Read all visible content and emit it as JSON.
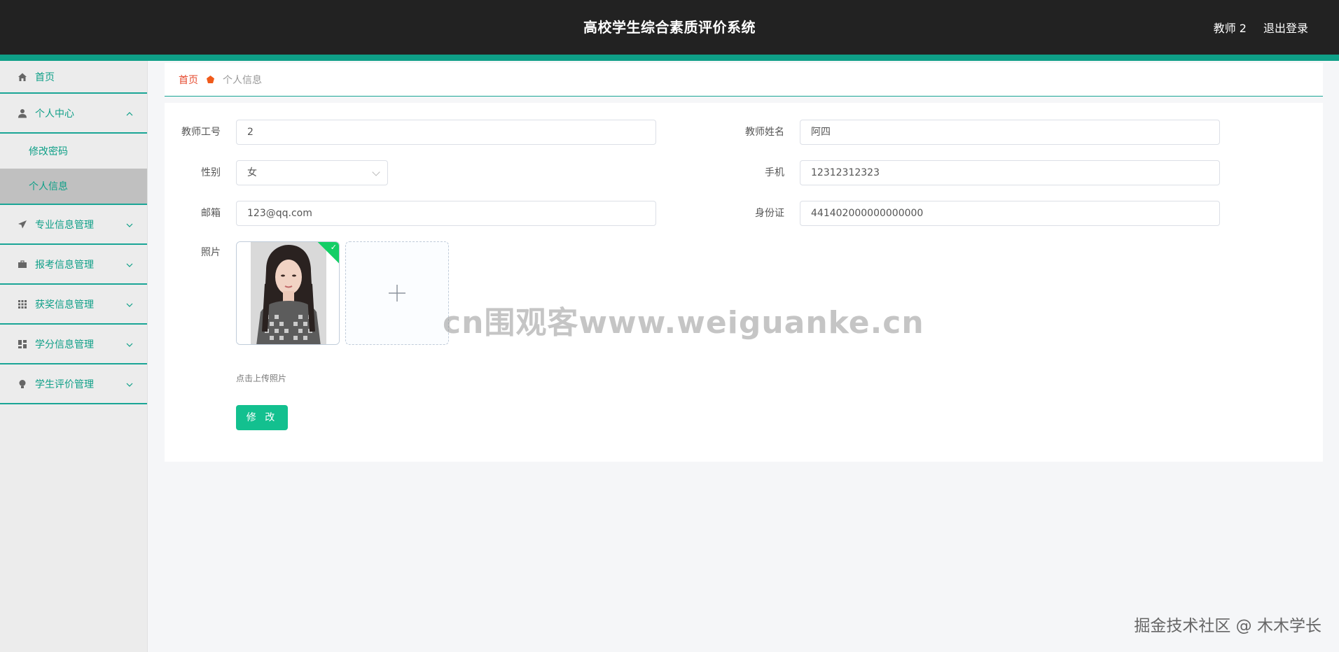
{
  "header": {
    "title": "高校学生综合素质评价系统",
    "user_name": "教师 2",
    "logout_label": "退出登录"
  },
  "sidebar": {
    "items": [
      {
        "label": "首页",
        "icon": "home-icon",
        "expanded": false
      },
      {
        "label": "个人中心",
        "icon": "user-icon",
        "expanded": true,
        "children": [
          {
            "label": "修改密码",
            "active": false
          },
          {
            "label": "个人信息",
            "active": true
          }
        ]
      },
      {
        "label": "专业信息管理",
        "icon": "paper-plane-icon",
        "expanded": false
      },
      {
        "label": "报考信息管理",
        "icon": "briefcase-icon",
        "expanded": false
      },
      {
        "label": "获奖信息管理",
        "icon": "grid-icon",
        "expanded": false
      },
      {
        "label": "学分信息管理",
        "icon": "dashboard-icon",
        "expanded": false
      },
      {
        "label": "学生评价管理",
        "icon": "lightbulb-icon",
        "expanded": false
      }
    ]
  },
  "breadcrumb": {
    "home": "首页",
    "current": "个人信息"
  },
  "form": {
    "teacher_id_label": "教师工号",
    "teacher_id_value": "2",
    "teacher_name_label": "教师姓名",
    "teacher_name_value": "阿四",
    "gender_label": "性别",
    "gender_value": "女",
    "phone_label": "手机",
    "phone_value": "12312312323",
    "email_label": "邮箱",
    "email_value": "123@qq.com",
    "idcard_label": "身份证",
    "idcard_value": "441402000000000000",
    "photo_label": "照片",
    "upload_hint": "点击上传照片",
    "submit_label": "修 改"
  },
  "watermarks": {
    "center": "cn围观客www.weiguanke.cn",
    "corner": "掘金技术社区 @ 木木学长"
  },
  "colors": {
    "header_bg": "#222222",
    "accent": "#0e9f87",
    "button": "#13c08f",
    "crumb_home": "#e64a2e"
  }
}
